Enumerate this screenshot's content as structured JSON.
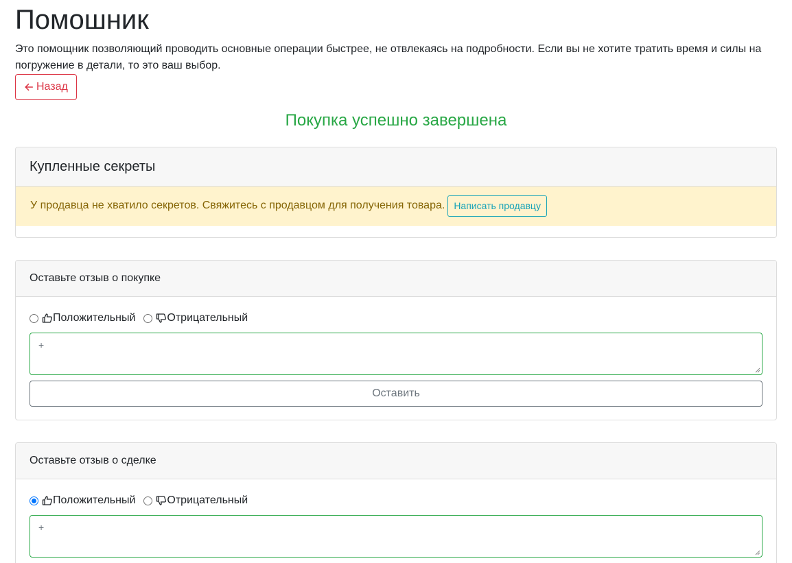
{
  "header": {
    "title": "Помошник",
    "intro": "Это помощник позволяющий проводить основные операции быстрее, не отвлекаясь на подробности. Если вы не хотите тратить время и силы на погружение в детали, то это ваш выбор.",
    "back_label": "Назад"
  },
  "status": {
    "message": "Покупка успешно завершена",
    "color": "#28a745"
  },
  "secrets": {
    "title": "Купленные секреты",
    "warning": "У продавца не хватило секретов. Свяжитесь с продавцом для получения товара.",
    "contact_label": "Написать продавцу"
  },
  "review_purchase": {
    "title": "Оставьте отзыв о покупке",
    "positive_label": "Положительный",
    "negative_label": "Отрицательный",
    "selected": "none",
    "text_value": "+",
    "submit_label": "Оставить"
  },
  "review_deal": {
    "title": "Оставьте отзыв о сделке",
    "positive_label": "Положительный",
    "negative_label": "Отрицательный",
    "selected": "positive",
    "text_value": "+"
  },
  "icons": {
    "back": "arrow-left-icon",
    "positive": "thumbs-up-icon",
    "negative": "thumbs-down-icon"
  },
  "colors": {
    "danger": "#dc3545",
    "success": "#28a745",
    "info": "#17a2b8",
    "warning_bg": "#fff3cd",
    "warning_text": "#856404"
  }
}
